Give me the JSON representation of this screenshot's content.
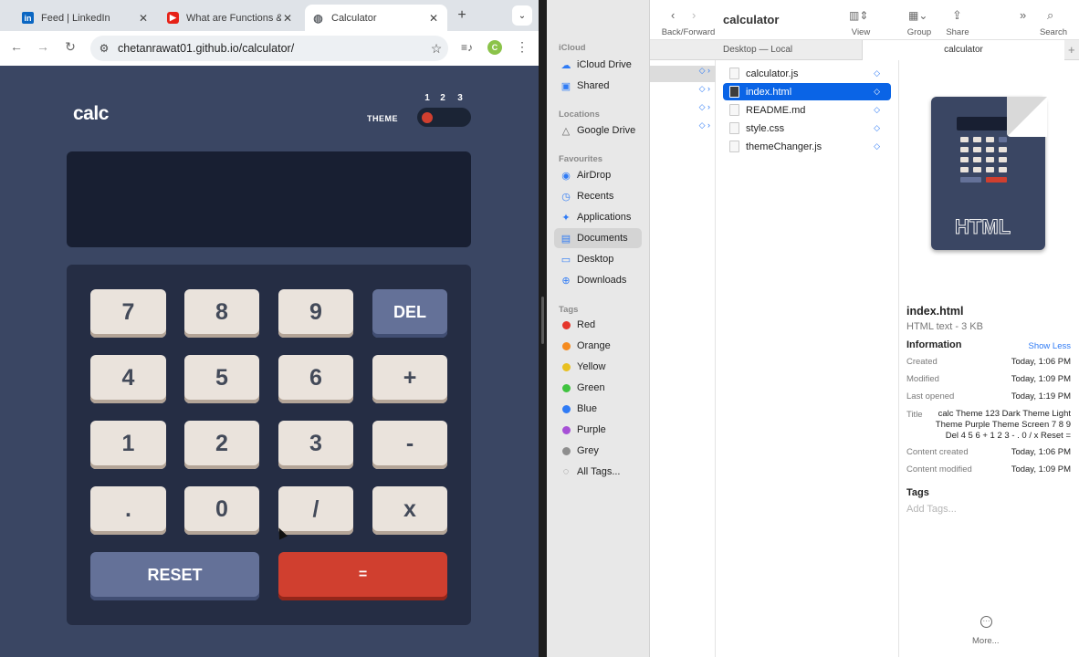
{
  "browser": {
    "tabs": [
      {
        "title": "Feed | LinkedIn",
        "icon": "linkedin-icon",
        "color": "#0a66c2"
      },
      {
        "title": "What are Functions &",
        "icon": "youtube-icon",
        "color": "#e62117"
      },
      {
        "title": "Calculator",
        "icon": "globe-icon",
        "color": "#5f6368"
      }
    ],
    "url": "chetanrawat01.github.io/calculator/",
    "profile_initial": "C"
  },
  "calculator": {
    "logo": "calc",
    "theme_label": "THEME",
    "theme_numbers": [
      "1",
      "2",
      "3"
    ],
    "active_theme": 1,
    "screen_value": "",
    "keys": {
      "k7": "7",
      "k8": "8",
      "k9": "9",
      "del": "DEL",
      "k4": "4",
      "k5": "5",
      "k6": "6",
      "plus": "+",
      "k1": "1",
      "k2": "2",
      "k3": "3",
      "minus": "-",
      "dot": ".",
      "k0": "0",
      "divide": "/",
      "times": "x",
      "reset": "RESET",
      "equals": "="
    },
    "colors": {
      "bg": "#3a4663",
      "accent_red": "#d03f2f",
      "accent_blue": "#647198"
    }
  },
  "finder": {
    "title": "calculator",
    "toolbar": {
      "back_forward": "Back/Forward",
      "view": "View",
      "group": "Group",
      "share": "Share",
      "search": "Search"
    },
    "path_left": "Desktop — Local",
    "path_right": "calculator",
    "sidebar": {
      "icloud_header": "iCloud",
      "icloud_items": [
        "iCloud Drive",
        "Shared"
      ],
      "locations_header": "Locations",
      "locations_items": [
        "Google Drive"
      ],
      "favourites_header": "Favourites",
      "favourites_items": [
        "AirDrop",
        "Recents",
        "Applications",
        "Documents",
        "Desktop",
        "Downloads"
      ],
      "tags_header": "Tags",
      "tags": [
        {
          "name": "Red",
          "color": "#e5352b"
        },
        {
          "name": "Orange",
          "color": "#f58b1f"
        },
        {
          "name": "Yellow",
          "color": "#e8c021"
        },
        {
          "name": "Green",
          "color": "#3fc33f"
        },
        {
          "name": "Blue",
          "color": "#2f7bf5"
        },
        {
          "name": "Purple",
          "color": "#a650d6"
        },
        {
          "name": "Grey",
          "color": "#8e8e8e"
        }
      ],
      "all_tags": "All Tags..."
    },
    "files": [
      "calculator.js",
      "index.html",
      "README.md",
      "style.css",
      "themeChanger.js"
    ],
    "selected_file": "index.html",
    "preview": {
      "icon_label": "HTML",
      "name": "index.html",
      "kind": "HTML text - 3 KB",
      "information": "Information",
      "show_less": "Show Less",
      "created_k": "Created",
      "created_v": "Today, 1:06 PM",
      "modified_k": "Modified",
      "modified_v": "Today, 1:09 PM",
      "last_opened_k": "Last opened",
      "last_opened_v": "Today, 1:19 PM",
      "title_k": "Title",
      "title_v": "calc Theme 123 Dark Theme Light Theme Purple Theme Screen 7 8 9 Del 4 5 6 + 1 2 3 - . 0 / x Reset =",
      "content_created_k": "Content created",
      "content_created_v": "Today, 1:06 PM",
      "content_modified_k": "Content modified",
      "content_modified_v": "Today, 1:09 PM",
      "tags": "Tags",
      "add_tags": "Add Tags...",
      "more": "More..."
    }
  }
}
